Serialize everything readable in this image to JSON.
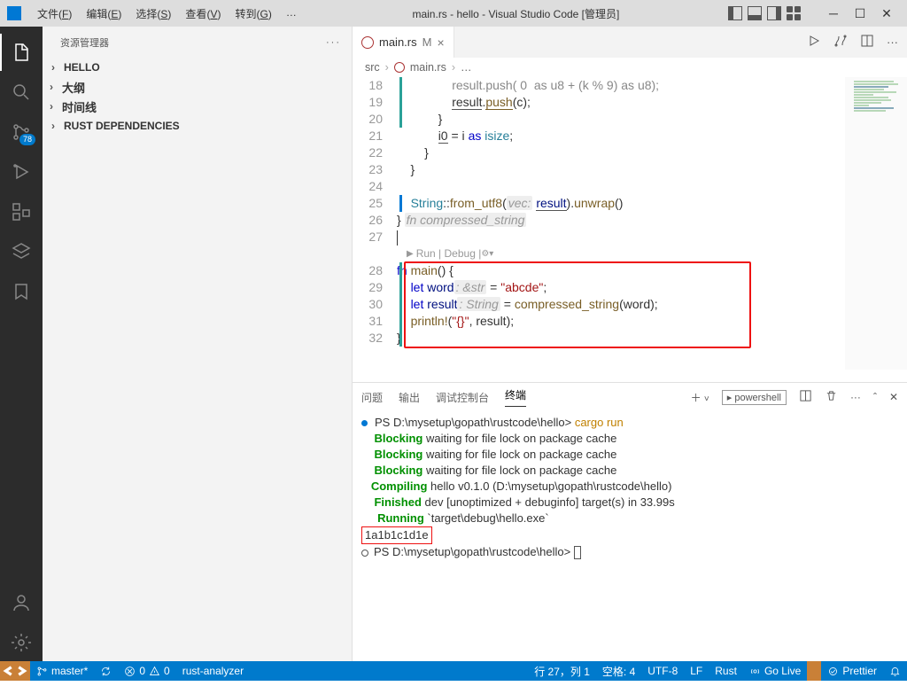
{
  "app": {
    "title": "main.rs - hello - Visual Studio Code [管理员]"
  },
  "menu": {
    "file": "文件",
    "file_h": "F",
    "edit": "编辑",
    "edit_h": "E",
    "select": "选择",
    "select_h": "S",
    "view": "查看",
    "view_h": "V",
    "goto": "转到",
    "goto_h": "G",
    "more": "…"
  },
  "activity": {
    "scm_badge": "78"
  },
  "sidebar": {
    "title": "资源管理器",
    "items": [
      "HELLO",
      "大纲",
      "时间线",
      "RUST DEPENDENCIES"
    ]
  },
  "tab": {
    "name": "main.rs",
    "mod": "M"
  },
  "breadcrumbs": {
    "a": "src",
    "b": "main.rs",
    "c": "…"
  },
  "code": {
    "start": 18,
    "codelens": "Run | Debug |",
    "lines": {
      "18": "                result.push('0' as u8 + (k % 9) as u8);",
      "19_a": "                ",
      "19_b": "result",
      "19_c": ".",
      "19_d": "push",
      "19_e": "(c);",
      "20": "            }",
      "21_a": "            ",
      "21_b": "i0",
      "21_c": " = i ",
      "21_kw": "as",
      "21_ty": " isize",
      "21_e": ";",
      "22": "        }",
      "23": "    }",
      "24": "",
      "25_a": "    ",
      "25_ty": "String",
      "25_b": "::",
      "25_fn": "from_utf8",
      "25_c": "(",
      "25_hint": "vec:",
      "25_d": " ",
      "25_var": "result",
      "25_e": ").",
      "25_fn2": "unwrap",
      "25_f": "()",
      "26_a": "} ",
      "26_hint": "fn compressed_string",
      "27": "",
      "28_a": "fn",
      "28_fn": " main",
      "28_b": "() {",
      "29_a": "    ",
      "29_kw": "let",
      "29_b": " word",
      "29_hint": ": &str",
      "29_c": " = ",
      "29_str": "\"abcde\"",
      "29_d": ";",
      "30_a": "    ",
      "30_kw": "let",
      "30_b": " result",
      "30_hint": ": String",
      "30_c": " = ",
      "30_fn": "compressed_string",
      "30_d": "(word);",
      "31_a": "    ",
      "31_fn": "println!",
      "31_b": "(",
      "31_str": "\"{}\"",
      "31_c": ", result);",
      "32": "}"
    }
  },
  "panel": {
    "tabs": [
      "问题",
      "输出",
      "调试控制台",
      "终端"
    ],
    "shell": "powershell",
    "term": {
      "ps1": "PS D:\\mysetup\\gopath\\rustcode\\hello> ",
      "cmd": "cargo run",
      "blk": "Blocking",
      "blk_msg": " waiting for file lock on package cache",
      "comp": "Compiling",
      "comp_msg": " hello v0.1.0 (D:\\mysetup\\gopath\\rustcode\\hello)",
      "fin": "Finished",
      "fin_msg": " dev [unoptimized + debuginfo] target(s) in 33.99s",
      "run": "Running",
      "run_msg": " `target\\debug\\hello.exe`",
      "out": "1a1b1c1d1e"
    }
  },
  "status": {
    "branch": "master*",
    "sync": "",
    "err": "0",
    "warn": "0",
    "analyzer": "rust-analyzer",
    "pos": "行 27，列 1",
    "spaces": "空格: 4",
    "enc": "UTF-8",
    "eol": "LF",
    "lang": "Rust",
    "golive": "Go Live",
    "prettier": "Prettier"
  }
}
